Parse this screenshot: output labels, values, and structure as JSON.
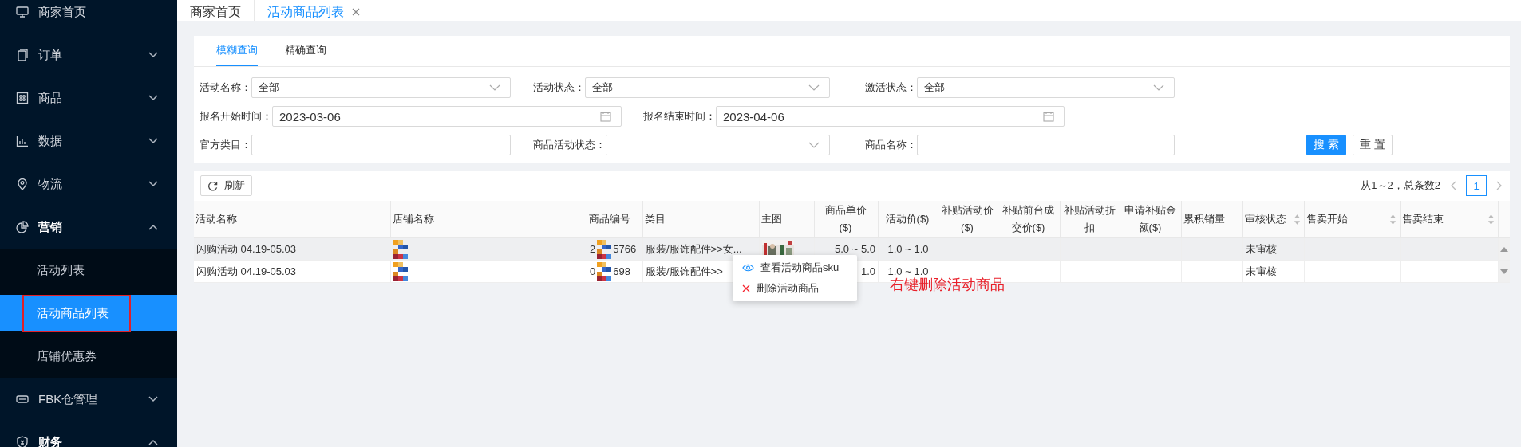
{
  "top_tabs": [
    {
      "label": "商家首页",
      "selected": false,
      "closable": false
    },
    {
      "label": "活动商品列表",
      "selected": true,
      "closable": true
    }
  ],
  "sidebar": {
    "items": [
      {
        "label": "商家首页",
        "expandable": false,
        "expanded": false
      },
      {
        "label": "订单",
        "expandable": true,
        "expanded": false
      },
      {
        "label": "商品",
        "expandable": true,
        "expanded": false
      },
      {
        "label": "数据",
        "expandable": true,
        "expanded": false
      },
      {
        "label": "物流",
        "expandable": true,
        "expanded": false
      },
      {
        "label": "营销",
        "expandable": true,
        "expanded": true,
        "children": [
          {
            "label": "活动列表",
            "selected": false,
            "annotated": false
          },
          {
            "label": "活动商品列表",
            "selected": true,
            "annotated": true
          },
          {
            "label": "店铺优惠券",
            "selected": false,
            "annotated": false
          }
        ]
      },
      {
        "label": "FBK仓管理",
        "expandable": true,
        "expanded": false
      },
      {
        "label": "财务",
        "expandable": true,
        "expanded": true
      }
    ]
  },
  "query_tabs": [
    {
      "label": "模糊查询",
      "selected": true
    },
    {
      "label": "精确查询",
      "selected": false
    }
  ],
  "filters": [
    [
      {
        "label": "活动名称：",
        "kind": "select",
        "value": "全部"
      },
      {
        "label": "活动状态：",
        "kind": "select",
        "value": "全部"
      },
      {
        "label": "激活状态：",
        "kind": "select",
        "value": "全部"
      }
    ],
    [
      {
        "label": "报名开始时间：",
        "kind": "date",
        "value": "2023-03-06"
      },
      {
        "label": "报名结束时间：",
        "kind": "date",
        "value": "2023-04-06"
      }
    ],
    [
      {
        "label": "官方类目：",
        "kind": "text"
      },
      {
        "label": "商品活动状态：",
        "kind": "select"
      },
      {
        "label": "商品名称：",
        "kind": "text"
      }
    ]
  ],
  "buttons": [
    {
      "label": "搜 索",
      "kind": "primary"
    },
    {
      "label": "重 置",
      "kind": "default"
    }
  ],
  "toolbar": {
    "refresh": "刷新",
    "summary": "从1～2，总条数2",
    "pages": [
      {
        "label": "1",
        "selected": true
      }
    ]
  },
  "table": {
    "columns": [
      {
        "label": [
          "活动名称"
        ],
        "sortable": false
      },
      {
        "label": [
          "店铺名称"
        ],
        "sortable": false
      },
      {
        "label": [
          "商品编号"
        ],
        "sortable": false
      },
      {
        "label": [
          "类目"
        ],
        "sortable": false
      },
      {
        "label": [
          "主图"
        ],
        "sortable": false
      },
      {
        "label": [
          "商品单价",
          "($)"
        ],
        "sortable": false
      },
      {
        "label": [
          "活动价($)"
        ],
        "sortable": false
      },
      {
        "label": [
          "补贴活动价",
          "($)"
        ],
        "sortable": false
      },
      {
        "label": [
          "补贴前台成",
          "交价($)"
        ],
        "sortable": false
      },
      {
        "label": [
          "补贴活动折",
          "扣"
        ],
        "sortable": false
      },
      {
        "label": [
          "申请补贴金",
          "额($)"
        ],
        "sortable": false
      },
      {
        "label": [
          "累积销量"
        ],
        "sortable": false
      },
      {
        "label": [
          "审核状态"
        ],
        "sortable": true
      },
      {
        "label": [
          "售卖开始"
        ],
        "sortable": true
      },
      {
        "label": [
          "售卖结束"
        ],
        "sortable": true
      }
    ],
    "rows": [
      {
        "highlighted": true,
        "cells": [
          {
            "kind": "text",
            "text": "闪购活动 04.19-05.03"
          },
          {
            "kind": "mosaic"
          },
          {
            "kind": "masked",
            "prefix": "2",
            "suffix": "5766"
          },
          {
            "kind": "text",
            "text": "服装/服饰配件>>女..."
          },
          {
            "kind": "picture"
          },
          {
            "kind": "text",
            "text": "5.0 ~ 5.0"
          },
          {
            "kind": "text",
            "text": "1.0 ~ 1.0"
          },
          {
            "kind": "empty"
          },
          {
            "kind": "empty"
          },
          {
            "kind": "empty"
          },
          {
            "kind": "empty"
          },
          {
            "kind": "empty"
          },
          {
            "kind": "text",
            "text": "未审核"
          },
          {
            "kind": "empty"
          },
          {
            "kind": "empty"
          }
        ]
      },
      {
        "highlighted": false,
        "cells": [
          {
            "kind": "text",
            "text": "闪购活动 04.19-05.03"
          },
          {
            "kind": "mosaic"
          },
          {
            "kind": "masked",
            "prefix": "0",
            "suffix": "698"
          },
          {
            "kind": "text",
            "text": "服装/服饰配件>>"
          },
          {
            "kind": "empty"
          },
          {
            "kind": "text",
            "text": "1.0"
          },
          {
            "kind": "text",
            "text": "1.0 ~ 1.0"
          },
          {
            "kind": "empty"
          },
          {
            "kind": "empty"
          },
          {
            "kind": "empty"
          },
          {
            "kind": "empty"
          },
          {
            "kind": "empty"
          },
          {
            "kind": "text",
            "text": "未审核"
          },
          {
            "kind": "empty"
          },
          {
            "kind": "empty"
          }
        ]
      }
    ]
  },
  "context_menu": {
    "items": [
      {
        "label": "查看活动商品sku",
        "kind": "view"
      },
      {
        "label": "删除活动商品",
        "kind": "delete"
      }
    ]
  },
  "annotation": "右键删除活动商品"
}
